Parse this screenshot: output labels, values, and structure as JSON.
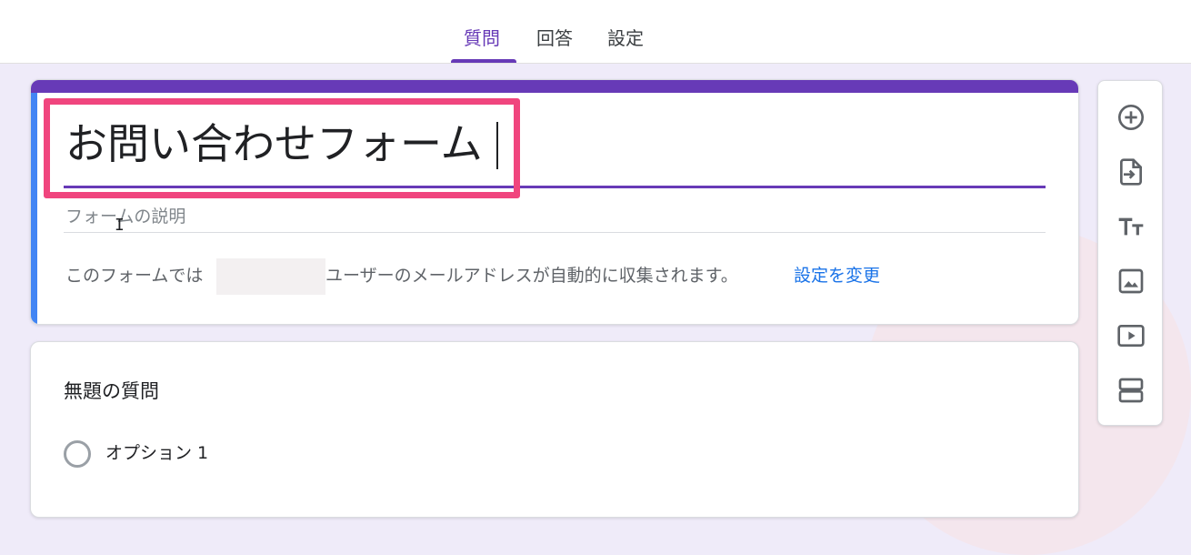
{
  "tabs": [
    {
      "label": "質問",
      "active": true
    },
    {
      "label": "回答",
      "active": false
    },
    {
      "label": "設定",
      "active": false
    }
  ],
  "form": {
    "title": "お問い合わせフォーム",
    "description_placeholder": "フォームの説明",
    "notice_prefix": "このフォームでは",
    "notice_suffix": "ユーザーのメールアドレスが自動的に収集されます。",
    "change_settings_link": "設定を変更"
  },
  "question": {
    "title": "無題の質問",
    "option_label": "オプション 1"
  },
  "toolbar": {
    "icons": [
      "add-question-icon",
      "import-questions-icon",
      "add-title-icon",
      "add-image-icon",
      "add-video-icon",
      "add-section-icon"
    ]
  },
  "colors": {
    "accent": "#673ab7",
    "left_stripe": "#4285f4",
    "highlight": "#f0457e",
    "link": "#1a73e8",
    "background": "#efebf9"
  }
}
